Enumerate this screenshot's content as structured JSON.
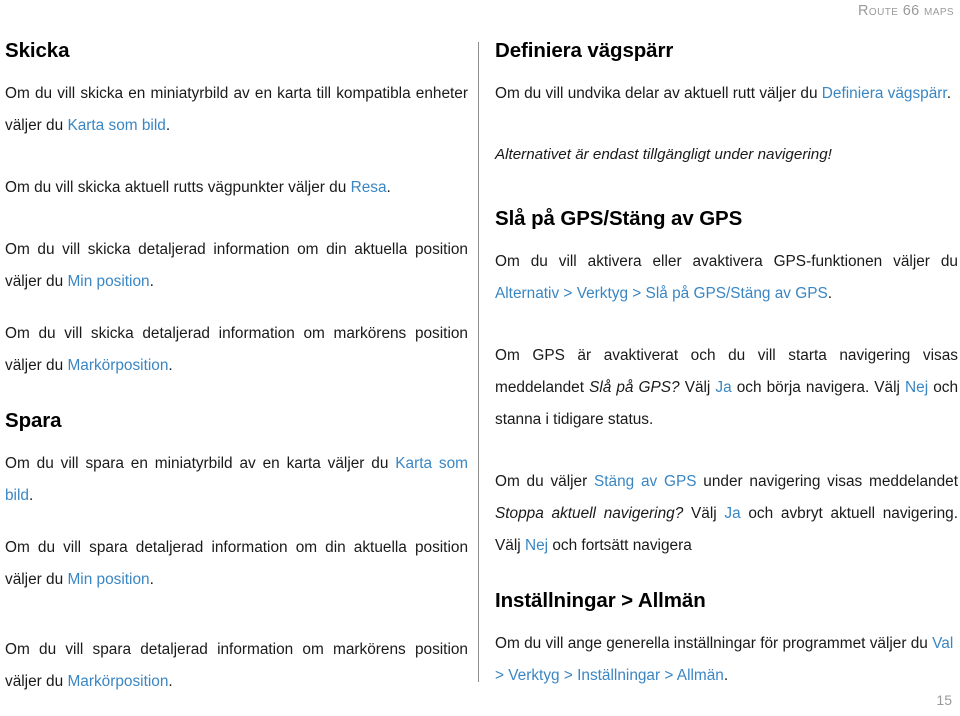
{
  "header": {
    "title": "ROUTE 66 MAPS"
  },
  "footer": {
    "page_number": "15"
  },
  "colors": {
    "link": "#3a86c3",
    "header_text": "#9a9a9a",
    "body_text": "#1a1a1a",
    "divider": "#8e8e8e"
  },
  "left_column": {
    "skicka": {
      "heading": "Skicka",
      "p1_a": "Om du vill skicka en miniatyrbild av en karta till kompatibla enheter väljer du ",
      "p1_link": "Karta som bild",
      "p1_b": ".",
      "p2_a": "Om du vill skicka aktuell rutts vägpunkter väljer du ",
      "p2_link": "Resa",
      "p2_b": ".",
      "p3_a": "Om du vill skicka detaljerad information om din aktuella position väljer du ",
      "p3_link": "Min position",
      "p3_b": ".",
      "p4_a": "Om du vill skicka detaljerad information om markörens position väljer du ",
      "p4_link": "Markörposition",
      "p4_b": "."
    },
    "spara": {
      "heading": "Spara",
      "p1_a": "Om du vill spara en miniatyrbild av en karta väljer du ",
      "p1_link": "Karta som bild",
      "p1_b": ".",
      "p2_a": "Om du vill spara detaljerad information om din aktuella position väljer du ",
      "p2_link": "Min position",
      "p2_b": ".",
      "p3_a": "Om du vill spara detaljerad information om markörens position väljer du ",
      "p3_link": "Markörposition",
      "p3_b": "."
    }
  },
  "right_column": {
    "vagsparr": {
      "heading": "Definiera vägspärr",
      "p1_a": "Om du vill undvika delar av aktuell rutt väljer du ",
      "p1_link": "Definiera vägspärr",
      "p1_b": ".",
      "note": "Alternativet är endast tillgängligt under navigering!"
    },
    "gps": {
      "heading": "Slå på GPS/Stäng av GPS",
      "p1_a": "Om du vill aktivera eller avaktivera GPS-funktionen väljer du ",
      "p1_link": "Alternativ > Verktyg > Slå på GPS/Stäng av GPS",
      "p1_b": ".",
      "p2_a": "Om GPS är avaktiverat och du vill starta navigering visas meddelandet ",
      "p2_ital": "Slå på GPS?",
      "p2_b": " Välj ",
      "p2_link1": "Ja",
      "p2_c": " och börja navigera. Välj ",
      "p2_link2": "Nej",
      "p2_d": " och stanna i tidigare status.",
      "p3_a": "Om du väljer ",
      "p3_link1": "Stäng av GPS",
      "p3_b": " under navigering visas meddelandet ",
      "p3_ital": "Stoppa aktuell navigering?",
      "p3_c": " Välj ",
      "p3_link2": "Ja",
      "p3_d": " och avbryt aktuell navigering. Välj ",
      "p3_link3": "Nej",
      "p3_e": " och fortsätt navigera"
    },
    "installningar": {
      "heading": "Inställningar > Allmän",
      "p1_a": "Om du vill ange generella inställningar för programmet väljer du ",
      "p1_link": "Val > Verktyg > Inställningar > Allmän",
      "p1_b": "."
    }
  }
}
